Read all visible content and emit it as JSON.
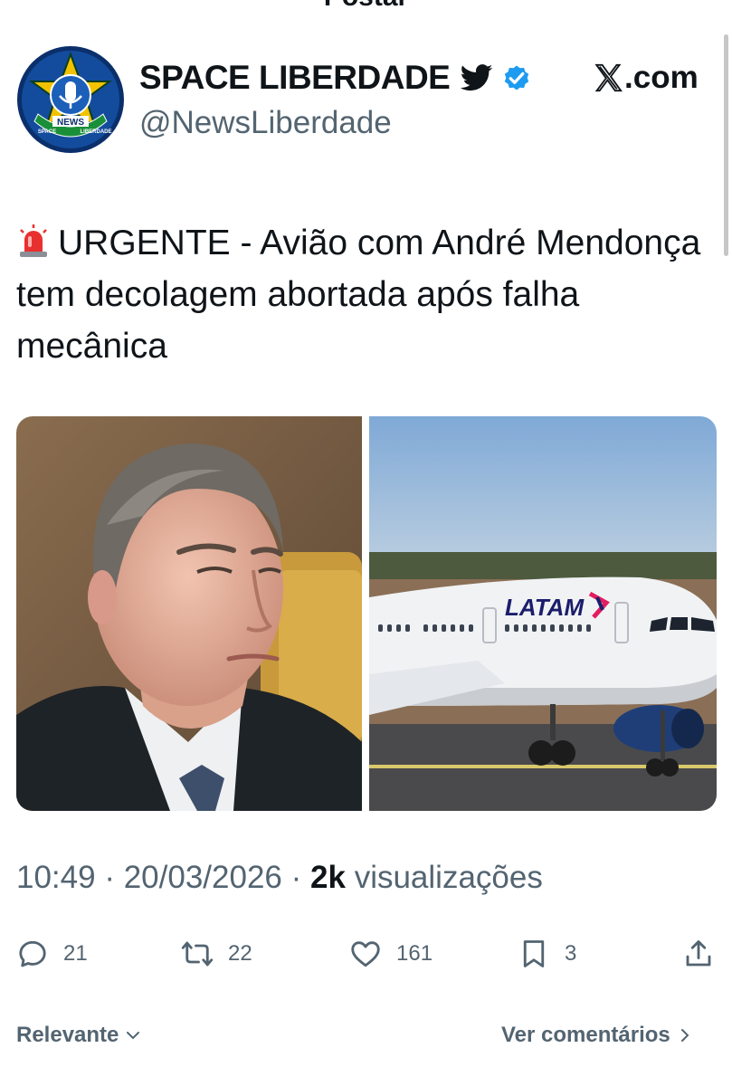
{
  "header": {
    "title": "Postar"
  },
  "author": {
    "name": "SPACE LIBERDADE",
    "handle": "@NewsLiberdade",
    "source": ".com",
    "avatar_text": {
      "center": "NEWS",
      "left": "SPACE",
      "right": "LIBERDADE"
    }
  },
  "post": {
    "text": "URGENTE - Avião com André Mendonça tem decolagem abortada após falha mecânica",
    "image_right_logo_text": "LATAM"
  },
  "meta": {
    "time": "10:49",
    "date": "20/03/2026",
    "views_count": "2k",
    "views_label": "visualizações"
  },
  "actions": {
    "replies": "21",
    "reposts": "22",
    "likes": "161",
    "bookmarks": "3"
  },
  "footer": {
    "sort_label": "Relevante",
    "comments_link": "Ver comentários"
  },
  "colors": {
    "verified": "#1d9bf0",
    "text": "#0f1419",
    "muted": "#536471"
  }
}
